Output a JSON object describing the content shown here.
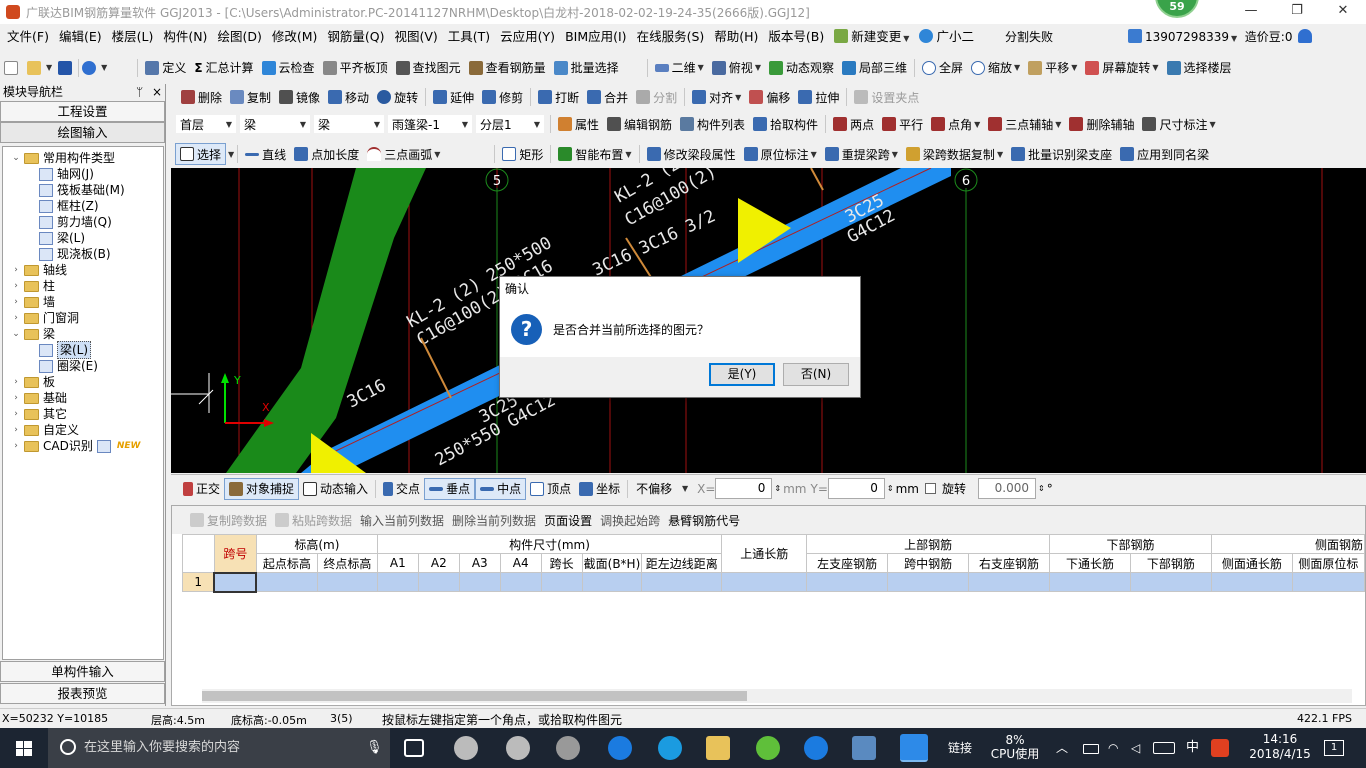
{
  "window": {
    "title": "广联达BIM钢筋算量软件 GGJ2013 - [C:\\Users\\Administrator.PC-20141127NRHM\\Desktop\\白龙村-2018-02-02-19-24-35(2666版).GGJ12]",
    "badge": "59",
    "minimize": "—",
    "restore": "❐",
    "close": "✕"
  },
  "menu": {
    "items": [
      "文件(F)",
      "编辑(E)",
      "楼层(L)",
      "构件(N)",
      "绘图(D)",
      "修改(M)",
      "钢筋量(Q)",
      "视图(V)",
      "工具(T)",
      "云应用(Y)",
      "BIM应用(I)",
      "在线服务(S)",
      "帮助(H)",
      "版本号(B)",
      "新建变更",
      "广小二"
    ],
    "split_fail": "分割失败",
    "phone": "13907298339",
    "bean": "造价豆:0"
  },
  "toolbar1": {
    "define": "定义",
    "sum": "汇总计算",
    "cloud_check": "云检查",
    "flush_slab": "平齐板顶",
    "find": "查找图元",
    "view_rebar": "查看钢筋量",
    "batch_select": "批量选择",
    "view2d": "二维",
    "topview": "俯视",
    "dynamic_view": "动态观察",
    "local3d": "局部三维",
    "fullscreen": "全屏",
    "zoom": "缩放",
    "pan": "平移",
    "rotate_screen": "屏幕旋转",
    "select_floor": "选择楼层"
  },
  "toolbar2": {
    "delete": "删除",
    "copy": "复制",
    "mirror": "镜像",
    "move": "移动",
    "rotate": "旋转",
    "extend": "延伸",
    "trim": "修剪",
    "break": "打断",
    "merge": "合并",
    "split": "分割",
    "align": "对齐",
    "offset": "偏移",
    "stretch": "拉伸",
    "set_grip": "设置夹点"
  },
  "toolbar3": {
    "floor": "首层",
    "cat1": "梁",
    "cat2": "梁",
    "component": "雨篷梁-1",
    "layer": "分层1",
    "property": "属性",
    "edit_rebar": "编辑钢筋",
    "comp_list": "构件列表",
    "pick": "拾取构件",
    "two_point": "两点",
    "parallel": "平行",
    "point_angle": "点角",
    "three_point_aux": "三点辅轴",
    "del_aux": "删除辅轴",
    "dim": "尺寸标注"
  },
  "toolbar4": {
    "select": "选择",
    "line": "直线",
    "point_length": "点加长度",
    "arc": "三点画弧",
    "rect": "矩形",
    "smart_layout": "智能布置",
    "modify_span": "修改梁段属性",
    "in_situ": "原位标注",
    "lift_span": "重提梁跨",
    "span_copy": "梁跨数据复制",
    "batch_support": "批量识别梁支座",
    "apply_same": "应用到同名梁"
  },
  "nav": {
    "header": "模块导航栏",
    "pin": "ᛘ",
    "close": "×",
    "project_settings": "工程设置",
    "drawing_input": "绘图输入",
    "single_input": "单构件输入",
    "report_preview": "报表预览",
    "tree": [
      {
        "label": "常用构件类型",
        "level": 0,
        "expander": "⌄",
        "kind": "folder"
      },
      {
        "label": "轴网(J)",
        "level": 1,
        "expander": "",
        "kind": "leaf"
      },
      {
        "label": "筏板基础(M)",
        "level": 1,
        "expander": "",
        "kind": "leaf"
      },
      {
        "label": "框柱(Z)",
        "level": 1,
        "expander": "",
        "kind": "leaf"
      },
      {
        "label": "剪力墙(Q)",
        "level": 1,
        "expander": "",
        "kind": "leaf"
      },
      {
        "label": "梁(L)",
        "level": 1,
        "expander": "",
        "kind": "leaf"
      },
      {
        "label": "现浇板(B)",
        "level": 1,
        "expander": "",
        "kind": "leaf"
      },
      {
        "label": "轴线",
        "level": 0,
        "expander": "›",
        "kind": "folder"
      },
      {
        "label": "柱",
        "level": 0,
        "expander": "›",
        "kind": "folder"
      },
      {
        "label": "墙",
        "level": 0,
        "expander": "›",
        "kind": "folder"
      },
      {
        "label": "门窗洞",
        "level": 0,
        "expander": "›",
        "kind": "folder"
      },
      {
        "label": "梁",
        "level": 0,
        "expander": "⌄",
        "kind": "folder"
      },
      {
        "label": "梁(L)",
        "level": 1,
        "expander": "",
        "kind": "leaf",
        "selected": true
      },
      {
        "label": "圈梁(E)",
        "level": 1,
        "expander": "",
        "kind": "leaf"
      },
      {
        "label": "板",
        "level": 0,
        "expander": "›",
        "kind": "folder"
      },
      {
        "label": "基础",
        "level": 0,
        "expander": "›",
        "kind": "folder"
      },
      {
        "label": "其它",
        "level": 0,
        "expander": "›",
        "kind": "folder"
      },
      {
        "label": "自定义",
        "level": 0,
        "expander": "›",
        "kind": "folder"
      },
      {
        "label": "CAD识别",
        "level": 0,
        "expander": "›",
        "kind": "folder",
        "new": "NEW"
      }
    ]
  },
  "canvas": {
    "axis5": "5",
    "axis6": "6",
    "texts": [
      "KL-2 (2)",
      "C16@100(2)",
      "3C16 3C16 3/2",
      "3C25",
      "G4C12",
      "KL-2 (2) 250*500",
      "C16@100(2) 2C16",
      "3C16",
      "3C25",
      "250*550 G4C12"
    ],
    "x_label": "X",
    "y_label": "Y"
  },
  "dialog": {
    "title": "确认",
    "icon": "?",
    "message": "是否合并当前所选择的图元？",
    "yes": "是(Y)",
    "no": "否(N)"
  },
  "snapbar": {
    "ortho": "正交",
    "snap": "对象捕捉",
    "dyn_input": "动态输入",
    "intersection": "交点",
    "perp": "垂点",
    "midpoint": "中点",
    "vertex": "顶点",
    "coord": "坐标",
    "offset_mode": "不偏移",
    "x_label": "X=",
    "x_value": "0",
    "y_label": "Y=",
    "y_value": "0",
    "unit": "mm",
    "rotate": "旋转",
    "rotate_value": "0.000",
    "degree": "°"
  },
  "grid": {
    "tools": [
      "复制跨数据",
      "粘贴跨数据",
      "输入当前列数据",
      "删除当前列数据",
      "页面设置",
      "调换起始跨",
      "悬臂钢筋代号"
    ],
    "h_span": "跨号",
    "h_elev": "标高(m)",
    "h_size": "构件尺寸(mm)",
    "h_top_through": "上通长筋",
    "h_top": "上部钢筋",
    "h_bottom": "下部钢筋",
    "h_side": "侧面钢筋",
    "sub": [
      "起点标高",
      "终点标高",
      "A1",
      "A2",
      "A3",
      "A4",
      "跨长",
      "截面(B*H)",
      "距左边线距离",
      "左支座钢筋",
      "跨中钢筋",
      "右支座钢筋",
      "下通长筋",
      "下部钢筋",
      "侧面通长筋",
      "侧面原位标"
    ],
    "row_no": "1"
  },
  "status": {
    "coords": "X=50232 Y=10185",
    "floor_height": "层高:4.5m",
    "base_elev": "底标高:-0.05m",
    "count": "3(5)",
    "hint": "按鼠标左键指定第一个角点，或拾取构件图元",
    "fps": "422.1 FPS"
  },
  "taskbar": {
    "search_placeholder": "在这里输入你要搜索的内容",
    "link": "链接",
    "cpu_pct": "8%",
    "cpu_label": "CPU使用",
    "ime": "中",
    "time": "14:16",
    "date": "2018/4/15",
    "notif": "1"
  },
  "colors": {
    "green_beam": "#1a8a1a",
    "blue_beam": "#1f8ef0",
    "yellow": "#f0f000",
    "grid_red": "#a01010"
  }
}
